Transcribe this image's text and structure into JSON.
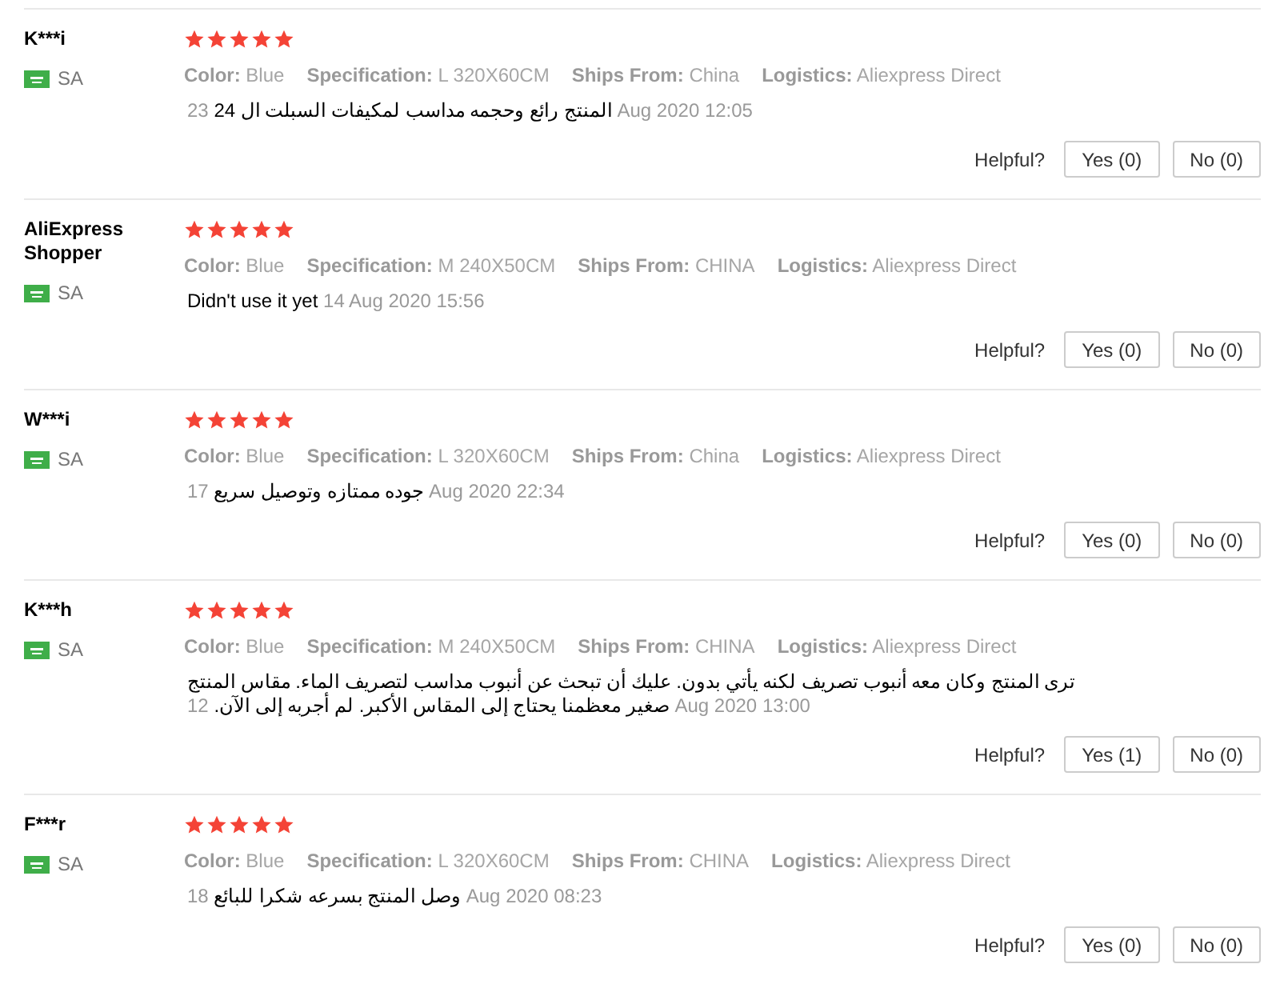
{
  "reviews": [
    {
      "name": "K***i",
      "country": "SA",
      "stars": 5,
      "attributes": [
        {
          "label": "Color:",
          "value": "Blue"
        },
        {
          "label": "Specification:",
          "value": "L 320X60CM"
        },
        {
          "label": "Ships From:",
          "value": "China"
        },
        {
          "label": "Logistics:",
          "value": "Aliexpress Direct"
        }
      ],
      "feedback": "المنتج رائع وحجمه مداسب لمكيفات السبلت ال 24",
      "date": "23 Aug 2020 12:05",
      "helpful": "Helpful?",
      "yes": "Yes (0)",
      "no": "No (0)"
    },
    {
      "name": "AliExpress Shopper",
      "country": "SA",
      "stars": 5,
      "attributes": [
        {
          "label": "Color:",
          "value": "Blue"
        },
        {
          "label": "Specification:",
          "value": "M 240X50CM"
        },
        {
          "label": "Ships From:",
          "value": "CHINA"
        },
        {
          "label": "Logistics:",
          "value": "Aliexpress Direct"
        }
      ],
      "feedback": "Didn't use it yet",
      "date": "14 Aug 2020 15:56",
      "helpful": "Helpful?",
      "yes": "Yes (0)",
      "no": "No (0)"
    },
    {
      "name": "W***i",
      "country": "SA",
      "stars": 5,
      "attributes": [
        {
          "label": "Color:",
          "value": "Blue"
        },
        {
          "label": "Specification:",
          "value": "L 320X60CM"
        },
        {
          "label": "Ships From:",
          "value": "China"
        },
        {
          "label": "Logistics:",
          "value": "Aliexpress Direct"
        }
      ],
      "feedback": "جوده ممتازه وتوصيل سريع",
      "date": "17 Aug 2020 22:34",
      "helpful": "Helpful?",
      "yes": "Yes (0)",
      "no": "No (0)"
    },
    {
      "name": "K***h",
      "country": "SA",
      "stars": 5,
      "attributes": [
        {
          "label": "Color:",
          "value": "Blue"
        },
        {
          "label": "Specification:",
          "value": "M 240X50CM"
        },
        {
          "label": "Ships From:",
          "value": "CHINA"
        },
        {
          "label": "Logistics:",
          "value": "Aliexpress Direct"
        }
      ],
      "feedback": "ترى المنتج وكان معه أنبوب تصريف لكنه يأتي بدون. عليك أن تبحث عن أنبوب مداسب لتصريف الماء. مقاس المنتج صغير معظمنا يحتاج إلى المقاس الأكبر. لم أجربه إلى الآن.",
      "date": "12 Aug 2020 13:00",
      "helpful": "Helpful?",
      "yes": "Yes (1)",
      "no": "No (0)"
    },
    {
      "name": "F***r",
      "country": "SA",
      "stars": 5,
      "attributes": [
        {
          "label": "Color:",
          "value": "Blue"
        },
        {
          "label": "Specification:",
          "value": "L 320X60CM"
        },
        {
          "label": "Ships From:",
          "value": "CHINA"
        },
        {
          "label": "Logistics:",
          "value": "Aliexpress Direct"
        }
      ],
      "feedback": "وصل المنتج بسرعه شكرا للبائع",
      "date": "18 Aug 2020 08:23",
      "helpful": "Helpful?",
      "yes": "Yes (0)",
      "no": "No (0)"
    }
  ]
}
